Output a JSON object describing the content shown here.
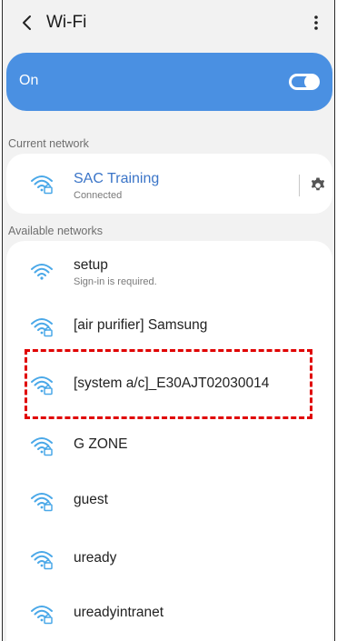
{
  "header": {
    "title": "Wi-Fi",
    "back_icon": "chevron-left-icon",
    "more_icon": "more-vert-icon"
  },
  "toggle": {
    "label": "On",
    "state": true
  },
  "current_network": {
    "section_label": "Current network",
    "ssid": "SAC Training",
    "status": "Connected",
    "icon": "wifi-lock-icon",
    "settings_icon": "gear-icon"
  },
  "available_networks": {
    "section_label": "Available networks",
    "items": [
      {
        "ssid": "setup",
        "sub": "Sign-in is required.",
        "secured": false
      },
      {
        "ssid": "[air purifier] Samsung",
        "sub": "",
        "secured": true
      },
      {
        "ssid": "[system a/c]_E30AJT02030014",
        "sub": "",
        "secured": true,
        "highlighted": true
      },
      {
        "ssid": "G ZONE",
        "sub": "",
        "secured": true
      },
      {
        "ssid": "guest",
        "sub": "",
        "secured": true
      },
      {
        "ssid": "uready",
        "sub": "",
        "secured": true
      },
      {
        "ssid": "ureadyintranet",
        "sub": "",
        "secured": true
      }
    ]
  },
  "colors": {
    "accent": "#4a90e2",
    "highlight": "#e00000",
    "wifi_icon": "#4aa8e8"
  }
}
